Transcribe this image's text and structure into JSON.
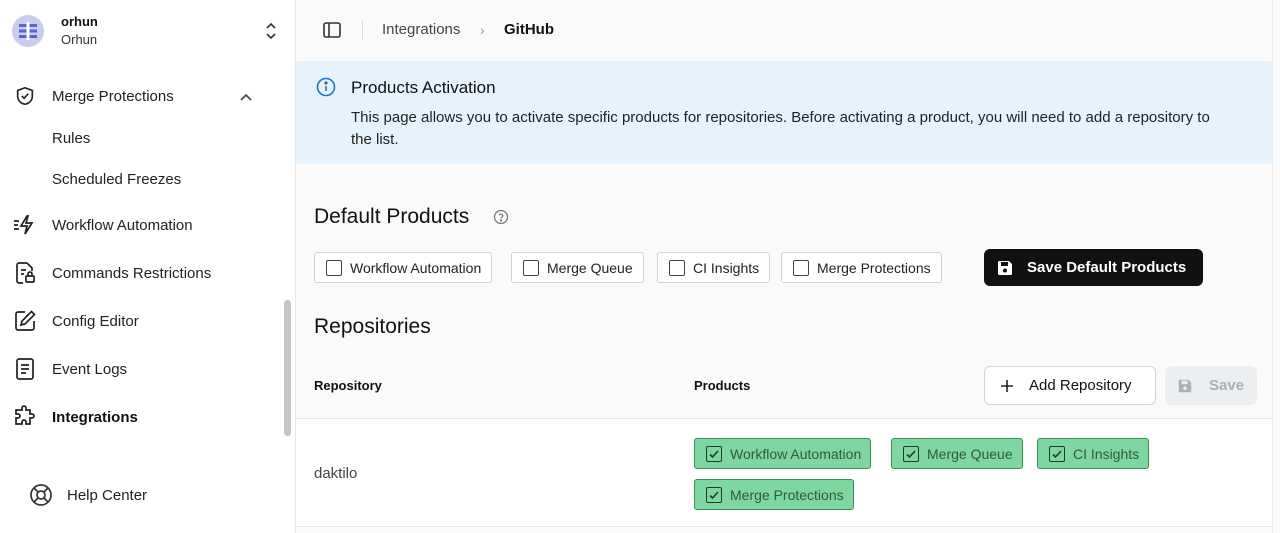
{
  "org": {
    "name": "orhun",
    "sub": "Orhun"
  },
  "sidebar": {
    "items": [
      {
        "label": "Merge Protections",
        "icon": "shield-check-icon"
      },
      {
        "label": "Rules"
      },
      {
        "label": "Scheduled Freezes"
      },
      {
        "label": "Workflow Automation",
        "icon": "zap-lines-icon"
      },
      {
        "label": "Commands Restrictions",
        "icon": "file-lock-icon"
      },
      {
        "label": "Config Editor",
        "icon": "edit-icon"
      },
      {
        "label": "Event Logs",
        "icon": "file-text-icon"
      },
      {
        "label": "Integrations",
        "icon": "puzzle-icon"
      }
    ],
    "help": "Help Center"
  },
  "breadcrumb": {
    "parent": "Integrations",
    "current": "GitHub"
  },
  "info": {
    "title": "Products Activation",
    "text": "This page allows you to activate specific products for repositories. Before activating a product, you will need to add a repository to the list."
  },
  "default_products": {
    "title": "Default Products",
    "options": [
      "Workflow Automation",
      "Merge Queue",
      "CI Insights",
      "Merge Protections"
    ],
    "save_label": "Save Default Products"
  },
  "repositories": {
    "title": "Repositories",
    "col_repository": "Repository",
    "col_products": "Products",
    "add_label": "Add Repository",
    "save_label": "Save",
    "rows": [
      {
        "name": "daktilo",
        "products": [
          "Workflow Automation",
          "Merge Queue",
          "CI Insights",
          "Merge Protections"
        ]
      }
    ]
  },
  "colors": {
    "accent": "#111111",
    "info_bg": "#e6f3fc",
    "active_chip": "#7ed6a1",
    "active_border": "#3b8f57"
  }
}
